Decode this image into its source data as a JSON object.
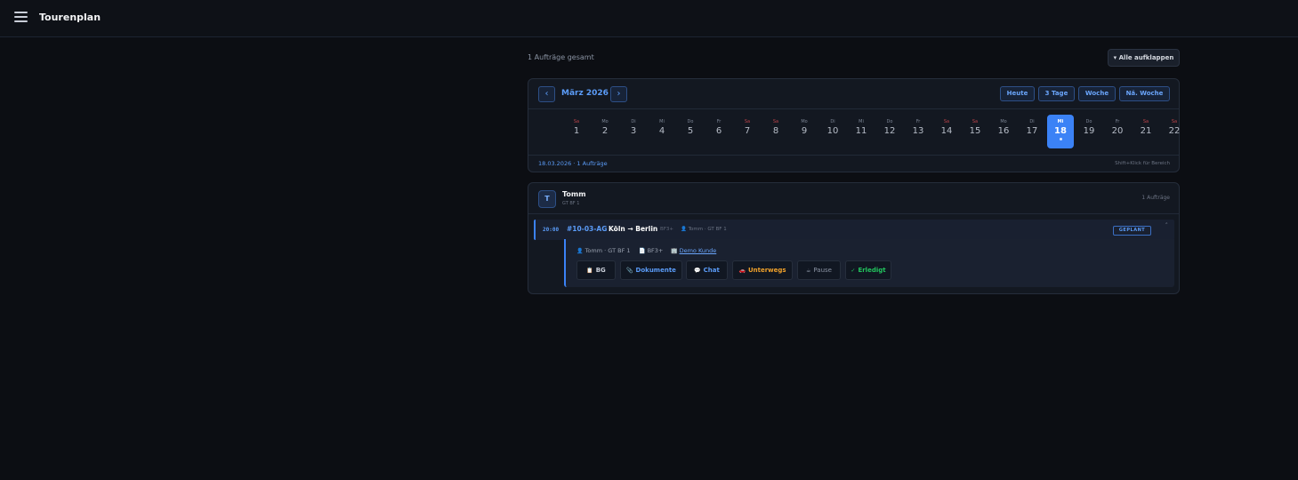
{
  "header": {
    "title": "Tourenplan",
    "menu_icon": "hamburger-icon"
  },
  "toolbar": {
    "summary": "1 Aufträge gesamt",
    "expand_all": "▾ Alle aufklappen"
  },
  "calendar": {
    "prev": "‹",
    "next": "›",
    "month": "März 2026",
    "views": [
      "Heute",
      "3 Tage",
      "Woche",
      "Nä. Woche"
    ],
    "days": [
      {
        "dow": "Sa",
        "num": "1",
        "weekend": true
      },
      {
        "dow": "Mo",
        "num": "2",
        "weekend": false
      },
      {
        "dow": "Di",
        "num": "3",
        "weekend": false
      },
      {
        "dow": "Mi",
        "num": "4",
        "weekend": false
      },
      {
        "dow": "Do",
        "num": "5",
        "weekend": false
      },
      {
        "dow": "Fr",
        "num": "6",
        "weekend": false
      },
      {
        "dow": "Sa",
        "num": "7",
        "weekend": true
      },
      {
        "dow": "Sa",
        "num": "8",
        "weekend": true
      },
      {
        "dow": "Mo",
        "num": "9",
        "weekend": false
      },
      {
        "dow": "Di",
        "num": "10",
        "weekend": false
      },
      {
        "dow": "Mi",
        "num": "11",
        "weekend": false
      },
      {
        "dow": "Do",
        "num": "12",
        "weekend": false
      },
      {
        "dow": "Fr",
        "num": "13",
        "weekend": false
      },
      {
        "dow": "Sa",
        "num": "14",
        "weekend": true
      },
      {
        "dow": "Sa",
        "num": "15",
        "weekend": true
      },
      {
        "dow": "Mo",
        "num": "16",
        "weekend": false
      },
      {
        "dow": "Di",
        "num": "17",
        "weekend": false
      },
      {
        "dow": "Mi",
        "num": "18",
        "weekend": false,
        "selected": true
      },
      {
        "dow": "Do",
        "num": "19",
        "weekend": false
      },
      {
        "dow": "Fr",
        "num": "20",
        "weekend": false
      },
      {
        "dow": "Sa",
        "num": "21",
        "weekend": true
      },
      {
        "dow": "Sa",
        "num": "22",
        "weekend": true
      }
    ],
    "footer_left": "18.03.2026 · 1 Aufträge",
    "footer_right": "Shift+Klick für Bereich"
  },
  "driver_group": {
    "avatar": "T",
    "name": "Tomm",
    "sub": "GT BF 1",
    "count": "1 Aufträge",
    "order": {
      "time": "20:00",
      "id": "#10-03-AG",
      "route": "Köln → Berlin",
      "class": "BF3+",
      "driver_icon": "person-icon",
      "driver": "Tomm · GT BF 1",
      "status": "GEPLANT",
      "collapse": "˄",
      "details": {
        "driver_icon": "person-icon",
        "driver": "Tomm · GT BF 1",
        "class_icon": "document-icon",
        "class": "BF3+",
        "customer_icon": "building-icon",
        "customer": "Demo Kunde"
      },
      "actions": {
        "bg": "BG",
        "dokumente": "Dokumente",
        "chat": "Chat",
        "unterwegs": "Unterwegs",
        "pause": "Pause",
        "erledigt": "Erledigt"
      }
    }
  },
  "colors": {
    "accent": "#3b82f6",
    "background": "#0c0e13",
    "panel": "#131821",
    "weekend": "#c2454b",
    "success": "#22c55e",
    "warning": "#f0a12b"
  }
}
